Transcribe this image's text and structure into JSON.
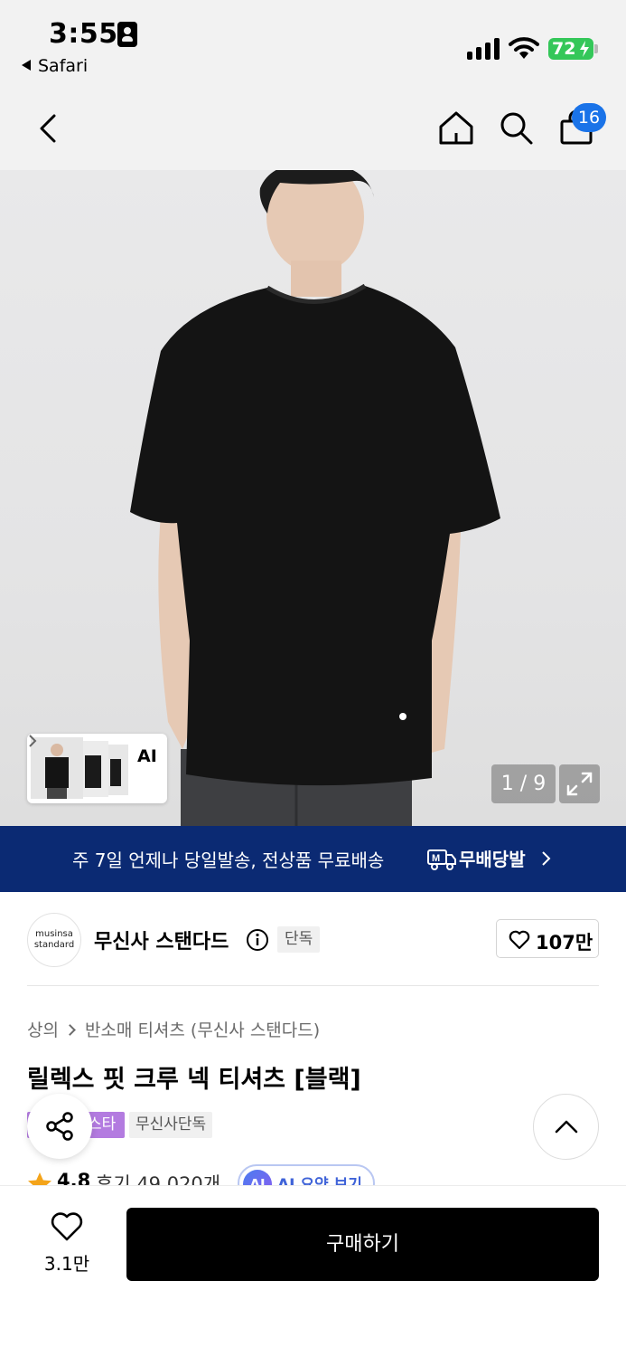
{
  "status_bar": {
    "time": "3:55",
    "back_app_label": "Safari",
    "battery_percent": "72",
    "signal_icon": "cellular-signal-icon",
    "wifi_icon": "wifi-icon",
    "battery_color": "#34c759"
  },
  "nav": {
    "cart_count": "16",
    "icons": [
      "chevron-left-icon",
      "home-icon",
      "search-icon",
      "shopping-bag-icon"
    ],
    "badge_color": "#1a73e8"
  },
  "gallery": {
    "thumb_label": "AI",
    "counter": "1 / 9",
    "expand_icon": "expand-icon"
  },
  "promo": {
    "text": "주 7일 언제나 당일발송, 전상품 무료배송",
    "brand": "무배당발",
    "background": "#0b2a73"
  },
  "brand": {
    "logo_line1": "musinsa",
    "logo_line2": "standard",
    "name": "무신사 스탠다드",
    "tag": "단독",
    "like_count": "107만"
  },
  "product": {
    "breadcrumb": [
      "상의",
      "반소매 티셔츠 (무신사 스탠다드)"
    ],
    "title": "릴렉스 핏 크루 넥 티셔츠 [블랙]",
    "tags": [
      "스타",
      "무신사단독"
    ],
    "rating": "4.8",
    "reviews": "후기 49,020개",
    "ai_badge": "AI",
    "ai_summary": "AI 요약 보기",
    "tag_purple_color": "#b37be0"
  },
  "bottom": {
    "wish_count": "3.1만",
    "buy_label": "구매하기"
  }
}
